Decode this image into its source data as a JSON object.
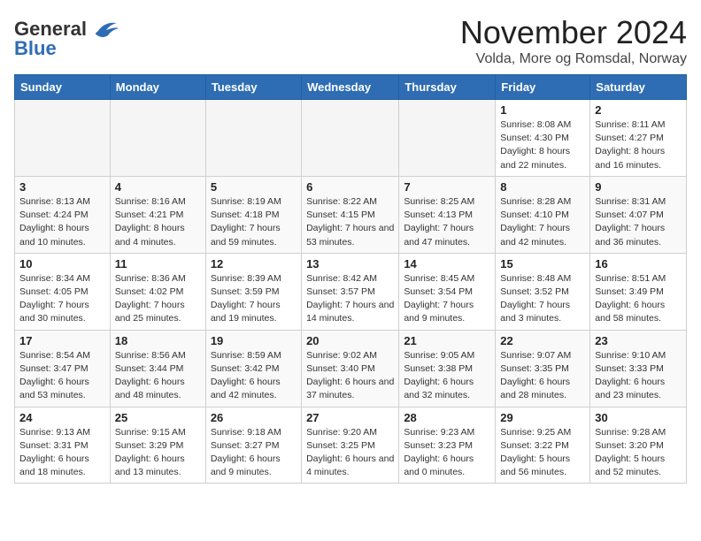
{
  "header": {
    "logo_general": "General",
    "logo_blue": "Blue",
    "month_title": "November 2024",
    "location": "Volda, More og Romsdal, Norway"
  },
  "columns": [
    "Sunday",
    "Monday",
    "Tuesday",
    "Wednesday",
    "Thursday",
    "Friday",
    "Saturday"
  ],
  "weeks": [
    [
      {
        "day": "",
        "empty": true
      },
      {
        "day": "",
        "empty": true
      },
      {
        "day": "",
        "empty": true
      },
      {
        "day": "",
        "empty": true
      },
      {
        "day": "",
        "empty": true
      },
      {
        "day": "1",
        "sunrise": "8:08 AM",
        "sunset": "4:30 PM",
        "daylight": "8 hours and 22 minutes."
      },
      {
        "day": "2",
        "sunrise": "8:11 AM",
        "sunset": "4:27 PM",
        "daylight": "8 hours and 16 minutes."
      }
    ],
    [
      {
        "day": "3",
        "sunrise": "8:13 AM",
        "sunset": "4:24 PM",
        "daylight": "8 hours and 10 minutes."
      },
      {
        "day": "4",
        "sunrise": "8:16 AM",
        "sunset": "4:21 PM",
        "daylight": "8 hours and 4 minutes."
      },
      {
        "day": "5",
        "sunrise": "8:19 AM",
        "sunset": "4:18 PM",
        "daylight": "7 hours and 59 minutes."
      },
      {
        "day": "6",
        "sunrise": "8:22 AM",
        "sunset": "4:15 PM",
        "daylight": "7 hours and 53 minutes."
      },
      {
        "day": "7",
        "sunrise": "8:25 AM",
        "sunset": "4:13 PM",
        "daylight": "7 hours and 47 minutes."
      },
      {
        "day": "8",
        "sunrise": "8:28 AM",
        "sunset": "4:10 PM",
        "daylight": "7 hours and 42 minutes."
      },
      {
        "day": "9",
        "sunrise": "8:31 AM",
        "sunset": "4:07 PM",
        "daylight": "7 hours and 36 minutes."
      }
    ],
    [
      {
        "day": "10",
        "sunrise": "8:34 AM",
        "sunset": "4:05 PM",
        "daylight": "7 hours and 30 minutes."
      },
      {
        "day": "11",
        "sunrise": "8:36 AM",
        "sunset": "4:02 PM",
        "daylight": "7 hours and 25 minutes."
      },
      {
        "day": "12",
        "sunrise": "8:39 AM",
        "sunset": "3:59 PM",
        "daylight": "7 hours and 19 minutes."
      },
      {
        "day": "13",
        "sunrise": "8:42 AM",
        "sunset": "3:57 PM",
        "daylight": "7 hours and 14 minutes."
      },
      {
        "day": "14",
        "sunrise": "8:45 AM",
        "sunset": "3:54 PM",
        "daylight": "7 hours and 9 minutes."
      },
      {
        "day": "15",
        "sunrise": "8:48 AM",
        "sunset": "3:52 PM",
        "daylight": "7 hours and 3 minutes."
      },
      {
        "day": "16",
        "sunrise": "8:51 AM",
        "sunset": "3:49 PM",
        "daylight": "6 hours and 58 minutes."
      }
    ],
    [
      {
        "day": "17",
        "sunrise": "8:54 AM",
        "sunset": "3:47 PM",
        "daylight": "6 hours and 53 minutes."
      },
      {
        "day": "18",
        "sunrise": "8:56 AM",
        "sunset": "3:44 PM",
        "daylight": "6 hours and 48 minutes."
      },
      {
        "day": "19",
        "sunrise": "8:59 AM",
        "sunset": "3:42 PM",
        "daylight": "6 hours and 42 minutes."
      },
      {
        "day": "20",
        "sunrise": "9:02 AM",
        "sunset": "3:40 PM",
        "daylight": "6 hours and 37 minutes."
      },
      {
        "day": "21",
        "sunrise": "9:05 AM",
        "sunset": "3:38 PM",
        "daylight": "6 hours and 32 minutes."
      },
      {
        "day": "22",
        "sunrise": "9:07 AM",
        "sunset": "3:35 PM",
        "daylight": "6 hours and 28 minutes."
      },
      {
        "day": "23",
        "sunrise": "9:10 AM",
        "sunset": "3:33 PM",
        "daylight": "6 hours and 23 minutes."
      }
    ],
    [
      {
        "day": "24",
        "sunrise": "9:13 AM",
        "sunset": "3:31 PM",
        "daylight": "6 hours and 18 minutes."
      },
      {
        "day": "25",
        "sunrise": "9:15 AM",
        "sunset": "3:29 PM",
        "daylight": "6 hours and 13 minutes."
      },
      {
        "day": "26",
        "sunrise": "9:18 AM",
        "sunset": "3:27 PM",
        "daylight": "6 hours and 9 minutes."
      },
      {
        "day": "27",
        "sunrise": "9:20 AM",
        "sunset": "3:25 PM",
        "daylight": "6 hours and 4 minutes."
      },
      {
        "day": "28",
        "sunrise": "9:23 AM",
        "sunset": "3:23 PM",
        "daylight": "6 hours and 0 minutes."
      },
      {
        "day": "29",
        "sunrise": "9:25 AM",
        "sunset": "3:22 PM",
        "daylight": "5 hours and 56 minutes."
      },
      {
        "day": "30",
        "sunrise": "9:28 AM",
        "sunset": "3:20 PM",
        "daylight": "5 hours and 52 minutes."
      }
    ]
  ]
}
